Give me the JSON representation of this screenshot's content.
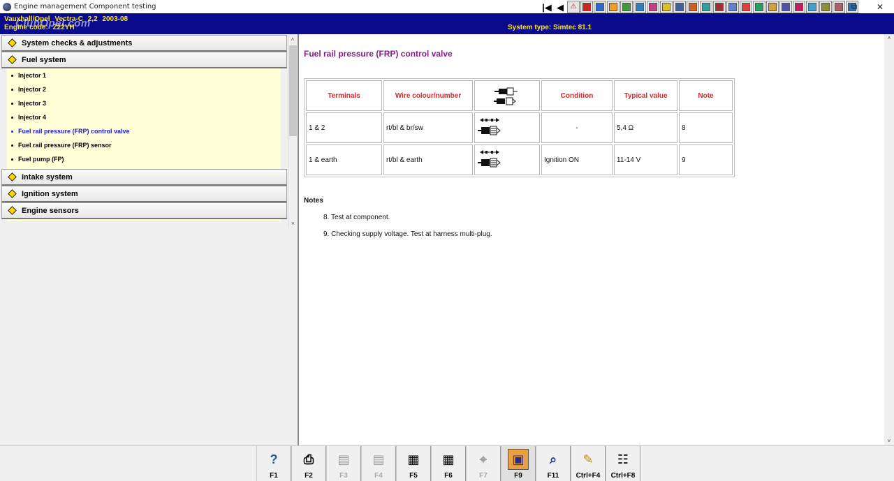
{
  "window": {
    "title": "Engine management Component testing",
    "controls": [
      "⧉",
      "✕"
    ]
  },
  "toolbar": {
    "buttons": [
      {
        "name": "first-page-icon",
        "glyph": "|◀"
      },
      {
        "name": "prev-page-icon",
        "glyph": "◀"
      },
      {
        "name": "warning-icon",
        "glyph": "⚠"
      },
      {
        "name": "tool-2",
        "glyph": ""
      },
      {
        "name": "tool-3",
        "glyph": ""
      },
      {
        "name": "tool-4",
        "glyph": ""
      },
      {
        "name": "tool-5",
        "glyph": ""
      },
      {
        "name": "tool-6",
        "glyph": ""
      },
      {
        "name": "tool-7",
        "glyph": ""
      },
      {
        "name": "tool-8",
        "glyph": ""
      },
      {
        "name": "tool-9",
        "glyph": ""
      },
      {
        "name": "tool-10",
        "glyph": ""
      },
      {
        "name": "tool-11",
        "glyph": ""
      },
      {
        "name": "tool-12",
        "glyph": ""
      },
      {
        "name": "tool-13",
        "glyph": ""
      },
      {
        "name": "tool-14",
        "glyph": ""
      },
      {
        "name": "tool-15",
        "glyph": ""
      },
      {
        "name": "tool-16",
        "glyph": ""
      },
      {
        "name": "tool-17",
        "glyph": ""
      },
      {
        "name": "tool-18",
        "glyph": ""
      },
      {
        "name": "tool-19",
        "glyph": ""
      },
      {
        "name": "tool-20",
        "glyph": ""
      },
      {
        "name": "tool-21",
        "glyph": ""
      },
      {
        "name": "tool-22",
        "glyph": ""
      }
    ]
  },
  "vehicle": {
    "make": "Vauxhall/Opel",
    "model": "Vectra-C",
    "engine_size": "2,2",
    "years": "2003-08",
    "engine_code_label": "Engine code:",
    "engine_code": "Z22YH",
    "system_type": "System type: Simtec 81.1",
    "watermark": "ClubOpel.com"
  },
  "sidebar": {
    "sections": [
      {
        "label": "System checks & adjustments",
        "expanded": false
      },
      {
        "label": "Fuel system",
        "expanded": true
      },
      {
        "label": "Intake system",
        "expanded": false
      },
      {
        "label": "Ignition system",
        "expanded": false
      },
      {
        "label": "Engine sensors",
        "expanded": false
      }
    ],
    "fuel_items": [
      {
        "label": "Injector 1"
      },
      {
        "label": "Injector 2"
      },
      {
        "label": "Injector 3"
      },
      {
        "label": "Injector 4"
      },
      {
        "label": "Fuel rail pressure (FRP) control valve"
      },
      {
        "label": "Fuel rail pressure (FRP) sensor"
      },
      {
        "label": "Fuel pump (FP)"
      }
    ],
    "active_item_index": 4
  },
  "main": {
    "title": "Fuel rail pressure (FRP) control valve",
    "table": {
      "headers": [
        "Terminals",
        "Wire colour/number",
        "",
        "Condition",
        "Typical value",
        "Note"
      ],
      "rows": [
        [
          "1 & 2",
          "rt/bl & br/sw",
          "",
          "-",
          "5,4 Ω",
          "8"
        ],
        [
          "1 & earth",
          "rt/bl & earth",
          "",
          "Ignition ON",
          "11-14 V",
          "9"
        ]
      ]
    },
    "notes_heading": "Notes",
    "notes": [
      "8. Test at component.",
      "9. Checking supply voltage. Test at harness multi-plug."
    ]
  },
  "fkeys": [
    {
      "label": "F1",
      "icon": "?",
      "enabled": true
    },
    {
      "label": "F2",
      "icon": "⎙",
      "enabled": true
    },
    {
      "label": "F3",
      "icon": "▤",
      "enabled": false
    },
    {
      "label": "F4",
      "icon": "▤",
      "enabled": false
    },
    {
      "label": "F5",
      "icon": "▦",
      "enabled": true
    },
    {
      "label": "F6",
      "icon": "▦",
      "enabled": true
    },
    {
      "label": "F7",
      "icon": "⌖",
      "enabled": false
    },
    {
      "label": "F9",
      "icon": "▣",
      "enabled": true
    },
    {
      "label": "F11",
      "icon": "⌕",
      "enabled": true
    },
    {
      "label": "Ctrl+F4",
      "icon": "✎",
      "enabled": true
    },
    {
      "label": "Ctrl+F8",
      "icon": "☷",
      "enabled": true
    }
  ],
  "colors": {
    "header_bg": "#0a0a8c",
    "header_text": "#ffe800",
    "title_color": "#8b1a8b",
    "table_header": "#e8202a",
    "active_item": "#1a1adc",
    "list_bg": "#ffffd8"
  }
}
